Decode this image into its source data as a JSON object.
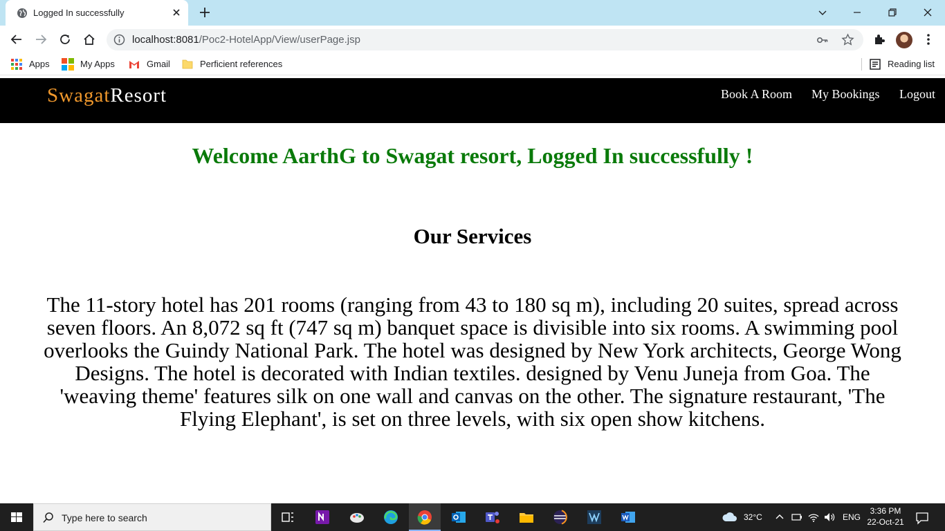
{
  "browser": {
    "tab_title": "Logged In successfully",
    "url_host": "localhost:8081",
    "url_path": "/Poc2-HotelApp/View/userPage.jsp",
    "bookmarks": [
      {
        "label": "Apps",
        "icon": "apps-grid-icon"
      },
      {
        "label": "My Apps",
        "icon": "microsoft-logo-icon"
      },
      {
        "label": "Gmail",
        "icon": "gmail-icon"
      },
      {
        "label": "Perficient references",
        "icon": "folder-icon"
      }
    ],
    "reading_list": "Reading list"
  },
  "site": {
    "brand_part1": "Swagat",
    "brand_part2": "Resort",
    "brand_color_accent": "#f0982c",
    "nav": [
      "Book A Room",
      "My Bookings",
      "Logout"
    ]
  },
  "page": {
    "welcome": "Welcome AarthG to Swagat resort, Logged In successfully !",
    "welcome_color": "#0a7a0a",
    "services_heading": "Our Services",
    "services_text": "The 11-story hotel has 201 rooms (ranging from 43 to 180 sq m), including 20 suites, spread across seven floors. An 8,072 sq ft (747 sq m) banquet space is divisible into six rooms. A swimming pool overlooks the Guindy National Park. The hotel was designed by New York architects, George Wong Designs. The hotel is decorated with Indian textiles. designed by Venu Juneja from Goa. The 'weaving theme' features silk on one wall and canvas on the other. The signature restaurant, 'The Flying Elephant', is set on three levels, with six open show kitchens."
  },
  "taskbar": {
    "search_placeholder": "Type here to search",
    "weather": "32°C",
    "language": "ENG",
    "time": "3:36 PM",
    "date": "22-Oct-21"
  }
}
